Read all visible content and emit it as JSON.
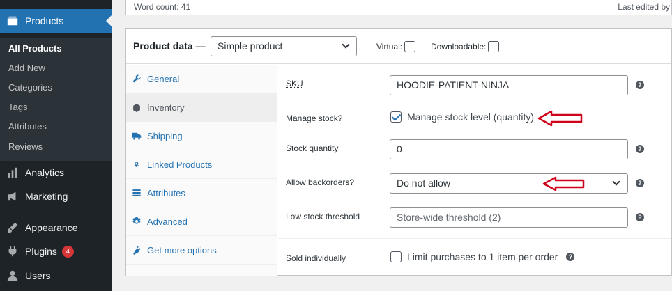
{
  "sidebar": {
    "products_label": "Products",
    "submenu": [
      {
        "label": "All Products",
        "current": true
      },
      {
        "label": "Add New"
      },
      {
        "label": "Categories"
      },
      {
        "label": "Tags"
      },
      {
        "label": "Attributes"
      },
      {
        "label": "Reviews"
      }
    ],
    "menu": [
      {
        "label": "Analytics",
        "icon": "analytics-icon"
      },
      {
        "label": "Marketing",
        "icon": "megaphone-icon"
      },
      {
        "label": "Appearance",
        "icon": "paintbrush-icon"
      },
      {
        "label": "Plugins",
        "icon": "plugin-icon",
        "badge": "4"
      },
      {
        "label": "Users",
        "icon": "users-icon"
      }
    ]
  },
  "editor": {
    "word_count": "Word count: 41",
    "last_edited": "Last edited by"
  },
  "product_data": {
    "title": "Product data —",
    "type_value": "Simple product",
    "virtual_label": "Virtual:",
    "downloadable_label": "Downloadable:",
    "virtual_checked": false,
    "downloadable_checked": false,
    "tabs": [
      {
        "label": "General",
        "icon": "wrench-icon"
      },
      {
        "label": "Inventory",
        "icon": "inventory-icon",
        "active": true
      },
      {
        "label": "Shipping",
        "icon": "truck-icon"
      },
      {
        "label": "Linked Products",
        "icon": "link-icon"
      },
      {
        "label": "Attributes",
        "icon": "list-icon"
      },
      {
        "label": "Advanced",
        "icon": "gear-icon"
      },
      {
        "label": "Get more options",
        "icon": "plug-icon"
      }
    ]
  },
  "inventory": {
    "sku_label": "SKU",
    "sku_value": "HOODIE-PATIENT-NINJA",
    "manage_stock_label": "Manage stock?",
    "manage_stock_text": "Manage stock level (quantity)",
    "manage_stock_checked": true,
    "stock_qty_label": "Stock quantity",
    "stock_qty_value": "0",
    "backorders_label": "Allow backorders?",
    "backorders_value": "Do not allow",
    "low_stock_label": "Low stock threshold",
    "low_stock_placeholder": "Store-wide threshold (2)",
    "sold_individually_label": "Sold individually",
    "sold_individually_text": "Limit purchases to 1 item per order",
    "sold_individually_checked": false,
    "help_glyph": "?"
  },
  "colors": {
    "sidebar_bg": "#1d2327",
    "active_menu": "#2271b1",
    "annotation_arrow": "#d0021b",
    "badge": "#d63638"
  }
}
